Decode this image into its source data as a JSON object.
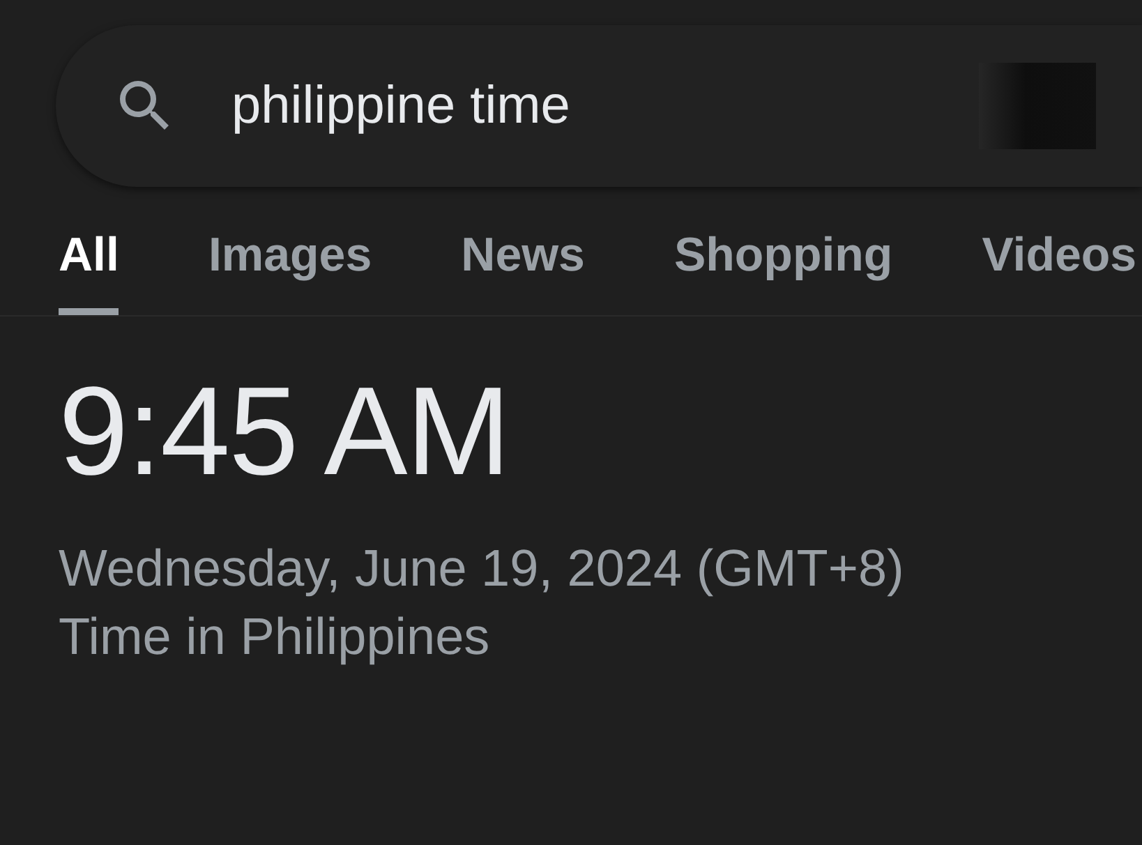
{
  "search": {
    "value": "philippine time"
  },
  "tabs": [
    {
      "label": "All",
      "selected": true
    },
    {
      "label": "Images",
      "selected": false
    },
    {
      "label": "News",
      "selected": false
    },
    {
      "label": "Shopping",
      "selected": false
    },
    {
      "label": "Videos",
      "selected": false
    }
  ],
  "result": {
    "time": "9:45 AM",
    "date": "Wednesday, June 19, 2024 (GMT+8)",
    "location": "Time in Philippines"
  }
}
